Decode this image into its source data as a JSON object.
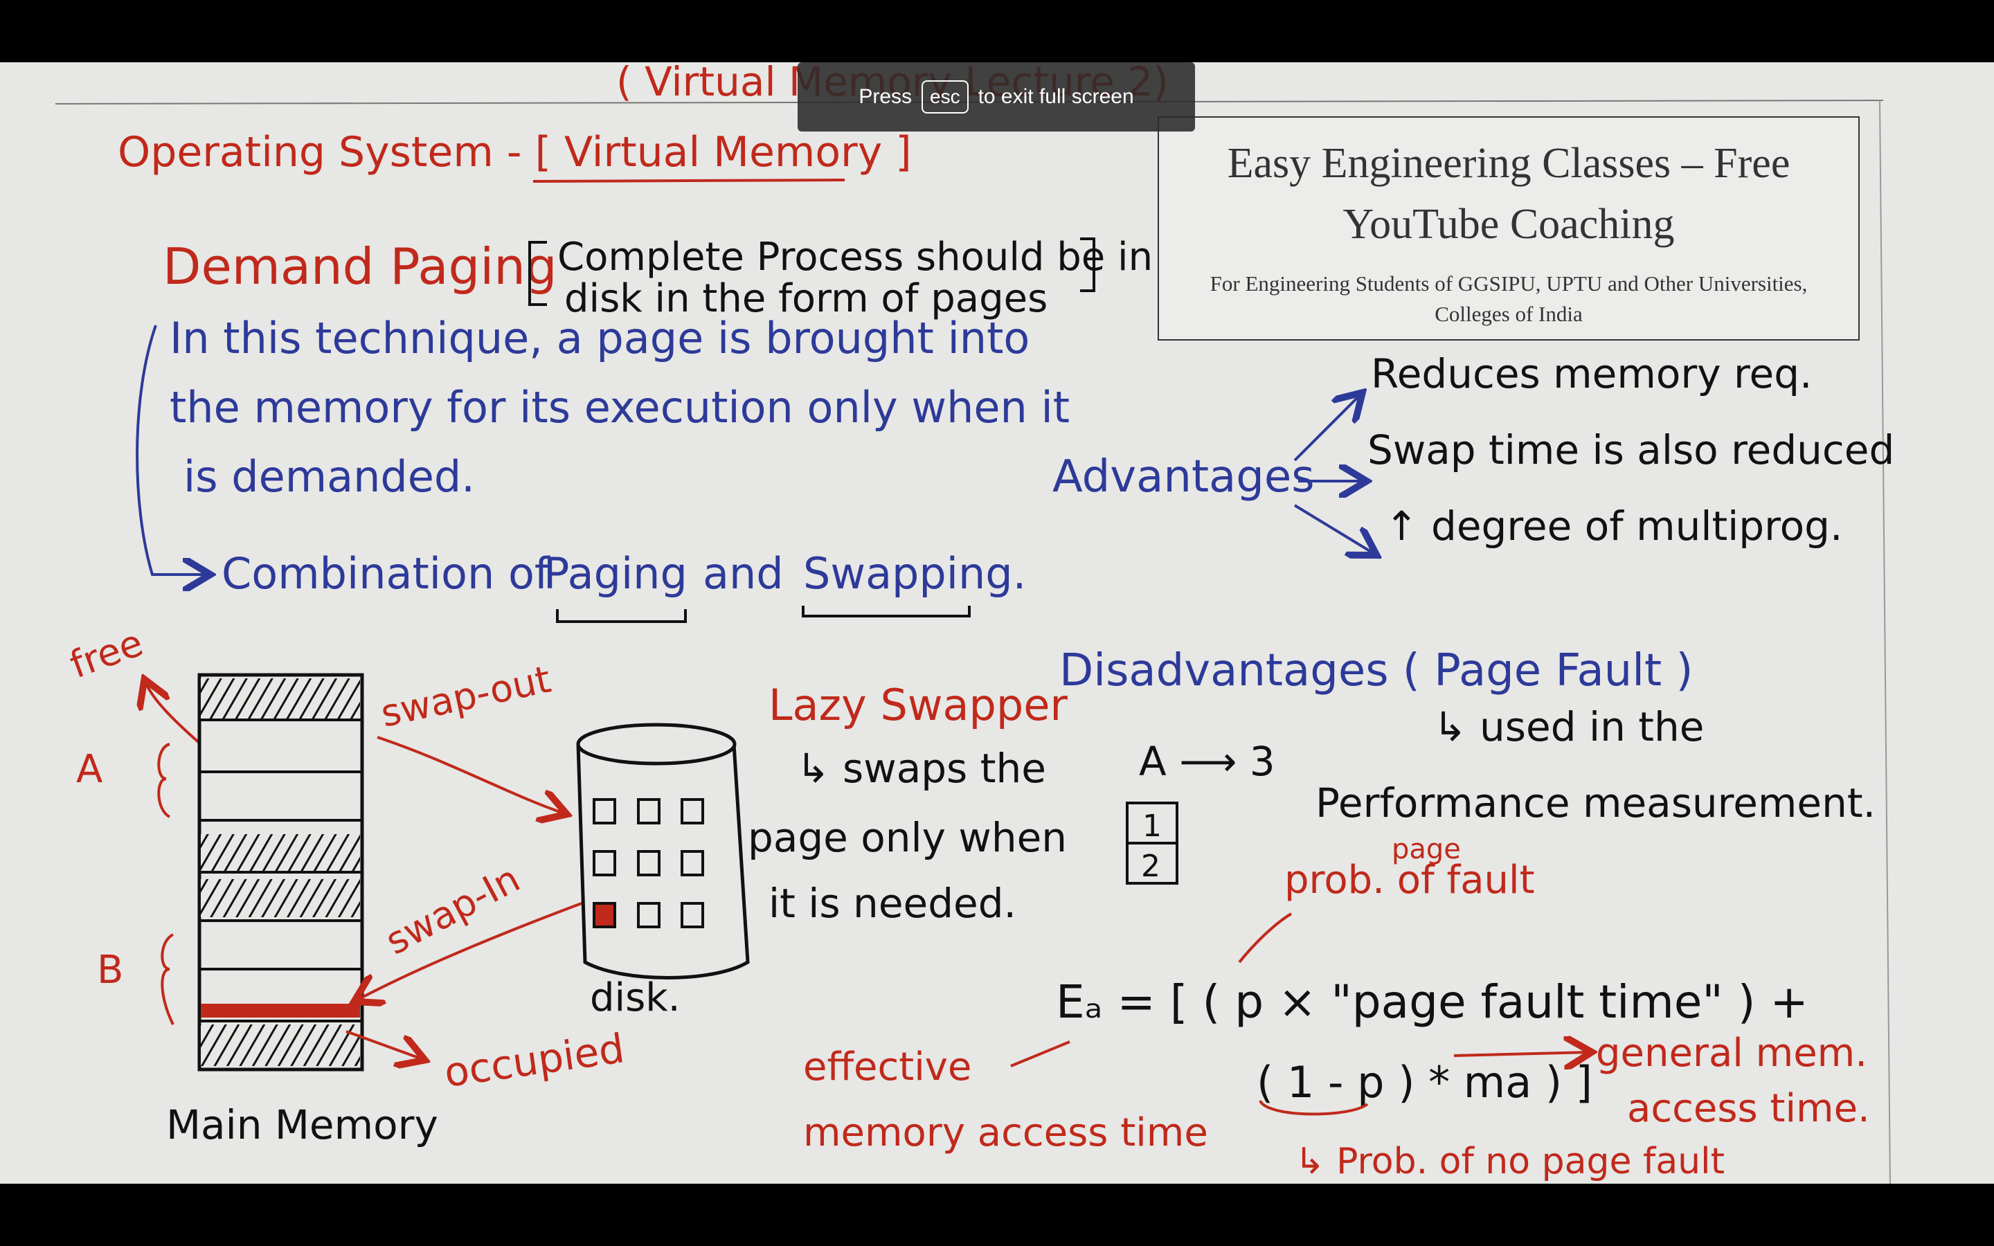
{
  "fullscreen_notice": {
    "press": "Press",
    "key": "esc",
    "rest": "to exit full screen"
  },
  "logo": {
    "title": "Easy Engineering Classes – Free YouTube Coaching",
    "subtitle": "For Engineering Students of GGSIPU, UPTU and Other Universities, Colleges of India"
  },
  "board": {
    "top_partial": "( Virtual Memory Lecture 2)",
    "heading": "Operating System - [ Virtual Memory ]",
    "demand_paging": "Demand Paging",
    "demand_note_1": "Complete Process should be in",
    "demand_note_2": "disk in the form of pages",
    "technique_1": "In this technique, a page is brought into",
    "technique_2": "the memory for its execution only when it",
    "technique_3": "is demanded.",
    "combination": "Combination of",
    "paging": "Paging",
    "and": "and",
    "swapping": "Swapping.",
    "advantages": "Advantages",
    "adv_1": "Reduces memory req.",
    "adv_2": "Swap time is also reduced",
    "adv_3": "↑ degree of multiprog.",
    "disadvantages": "Disadvantages ( Page Fault )",
    "used_in": "↳ used in the",
    "performance": "Performance measurement.",
    "free": "free",
    "label_a": "A",
    "label_b": "B",
    "swap_out": "swap-out",
    "swap_in": "swap-In",
    "occupied": "occupied",
    "main_memory": "Main Memory",
    "disk": "disk.",
    "lazy_swapper": "Lazy Swapper",
    "lazy_1": "↳ swaps the",
    "lazy_2": "page only when",
    "lazy_3": "it is needed.",
    "a_to_3": "A ⟶ 3",
    "cell_1": "1",
    "cell_2": "2",
    "page_small": "page",
    "prob_fault": "prob. of fault",
    "formula_1": "Eₐ = [ ( p × \"page fault time\" ) +",
    "formula_2": "( 1 - p ) * ma ) ]",
    "general_1": "general mem.",
    "general_2": "access time.",
    "effective_1": "effective",
    "effective_2": "memory access time",
    "prob_no_fault": "↳ Prob. of no page fault"
  }
}
